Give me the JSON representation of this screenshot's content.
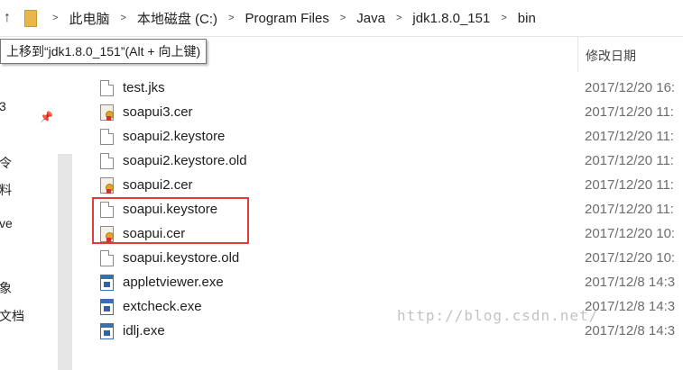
{
  "address_bar": {
    "up_icon": "arrow-up-icon",
    "folder_icon": "folder-icon",
    "separator": ">",
    "breadcrumbs": [
      "此电脑",
      "本地磁盘 (C:)",
      "Program Files",
      "Java",
      "jdk1.8.0_151",
      "bin"
    ]
  },
  "tooltip": {
    "text": "上移到“jdk1.8.0_151”(Alt + 向上键)"
  },
  "nav": {
    "pin_icon": "pin-icon",
    "fragments": [
      "3",
      "令",
      "料",
      "ve",
      "象",
      "文档"
    ]
  },
  "columns": {
    "date_modified": "修改日期"
  },
  "files": [
    {
      "name": "test.jks",
      "date": "2017/12/20 16:",
      "icon": "document-icon"
    },
    {
      "name": "soapui3.cer",
      "date": "2017/12/20 11:",
      "icon": "certificate-icon"
    },
    {
      "name": "soapui2.keystore",
      "date": "2017/12/20 11:",
      "icon": "document-icon"
    },
    {
      "name": "soapui2.keystore.old",
      "date": "2017/12/20 11:",
      "icon": "document-icon"
    },
    {
      "name": "soapui2.cer",
      "date": "2017/12/20 11:",
      "icon": "certificate-icon"
    },
    {
      "name": "soapui.keystore",
      "date": "2017/12/20 11:",
      "icon": "document-icon"
    },
    {
      "name": "soapui.cer",
      "date": "2017/12/20 10:",
      "icon": "certificate-icon"
    },
    {
      "name": "soapui.keystore.old",
      "date": "2017/12/20 10:",
      "icon": "document-icon"
    },
    {
      "name": "appletviewer.exe",
      "date": "2017/12/8 14:3",
      "icon": "executable-icon"
    },
    {
      "name": "extcheck.exe",
      "date": "2017/12/8 14:3",
      "icon": "executable-icon"
    },
    {
      "name": "idlj.exe",
      "date": "2017/12/8 14:3",
      "icon": "executable-icon"
    }
  ],
  "highlight_color": "#e33b3b",
  "watermark": "http://blog.csdn.net/"
}
